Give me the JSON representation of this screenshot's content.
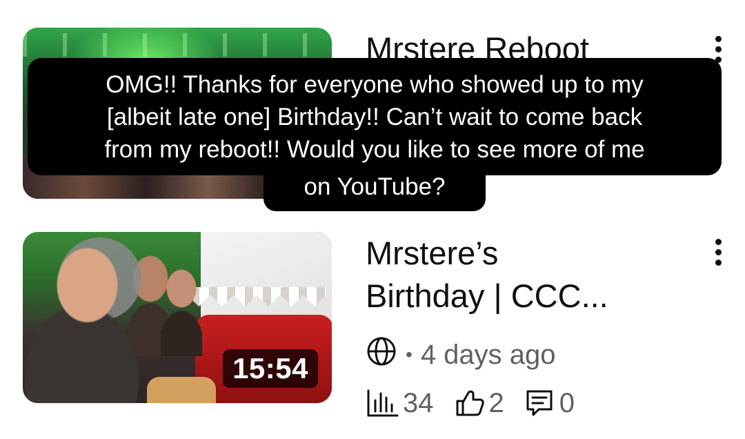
{
  "videos": [
    {
      "title": "Mrstere Reboot",
      "duration": ""
    },
    {
      "title_line1": "Mrstere’s",
      "title_line2": "Birthday | CCC...",
      "duration": "15:54",
      "visibility_icon": "globe-icon",
      "separator": "•",
      "age": "4 days ago",
      "views": "34",
      "likes": "2",
      "comments": "0"
    }
  ],
  "caption": {
    "lines": [
      "OMG!! Thanks for everyone who showed up to my",
      "[albeit late one] Birthday!! Can’t wait to come back",
      "from my reboot!! Would you like to see more of me",
      "on YouTube?"
    ]
  },
  "colors": {
    "text_primary": "#0f0f0f",
    "text_secondary": "#606060",
    "caption_bg": "#000000",
    "caption_text": "#ffffff",
    "duration_bg": "rgba(0,0,0,0.72)"
  }
}
